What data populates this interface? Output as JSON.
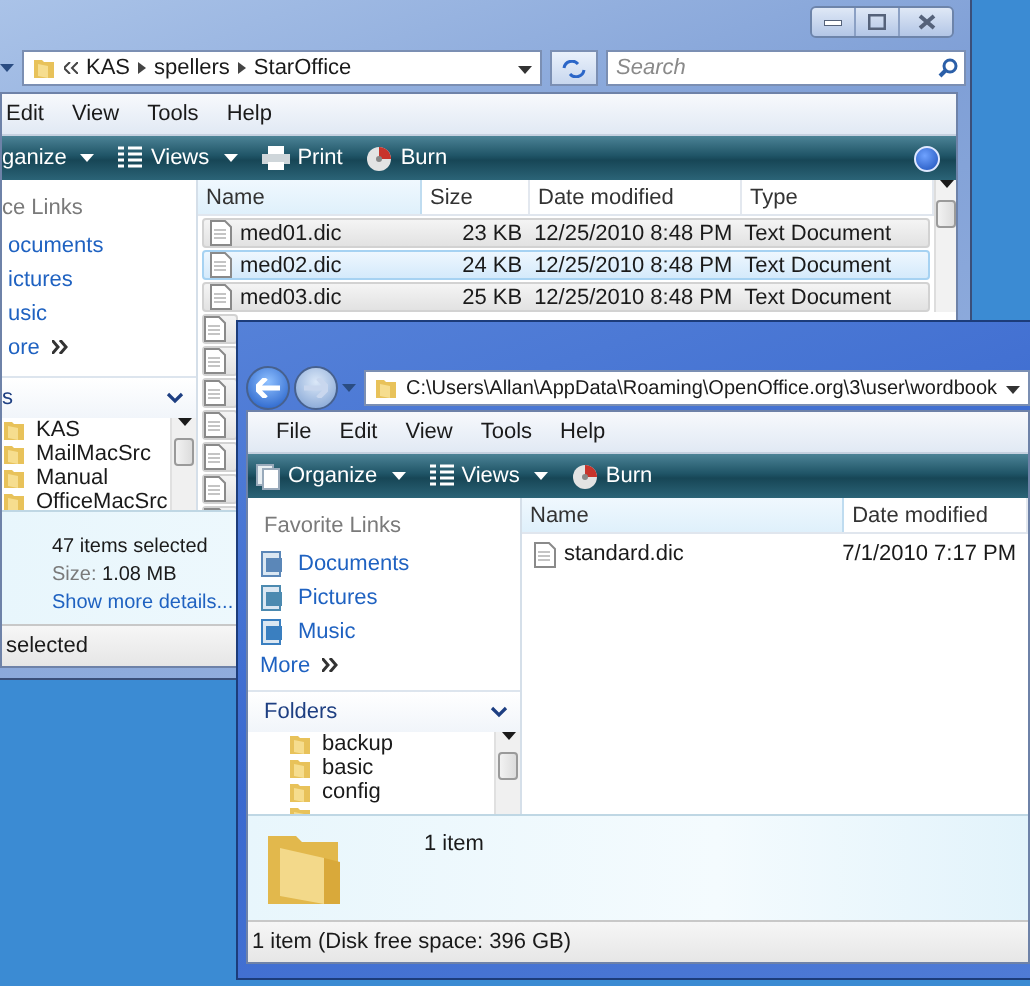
{
  "back_window": {
    "address": {
      "path": [
        "KAS",
        "spellers",
        "StarOffice"
      ]
    },
    "search": {
      "placeholder": "Search"
    },
    "menu": [
      "Edit",
      "View",
      "Tools",
      "Help"
    ],
    "toolbar": [
      {
        "label": "ganize",
        "kind": "organize"
      },
      {
        "label": "Views",
        "kind": "views"
      },
      {
        "label": "Print",
        "kind": "print"
      },
      {
        "label": "Burn",
        "kind": "burn"
      }
    ],
    "favorite_links": {
      "title": "ce Links",
      "items": [
        "ocuments",
        "ictures",
        "usic"
      ],
      "more": "ore"
    },
    "folders": {
      "title": "s",
      "items": [
        "KAS",
        "MailMacSrc",
        "Manual",
        "OfficeMacSrc"
      ]
    },
    "columns": [
      "Name",
      "Size",
      "Date modified",
      "Type"
    ],
    "rows": [
      {
        "name": "med01.dic",
        "size": "23 KB",
        "date": "12/25/2010 8:48 PM",
        "type": "Text Document",
        "selected": true,
        "focused": false
      },
      {
        "name": "med02.dic",
        "size": "24 KB",
        "date": "12/25/2010 8:48 PM",
        "type": "Text Document",
        "selected": true,
        "focused": true
      },
      {
        "name": "med03.dic",
        "size": "25 KB",
        "date": "12/25/2010 8:48 PM",
        "type": "Text Document",
        "selected": true,
        "focused": false
      }
    ],
    "details": {
      "summary": "47 items selected",
      "size_label": "Size:",
      "size": "1.08 MB",
      "link": "Show more details..."
    },
    "status": "selected"
  },
  "front_window": {
    "address": {
      "path_text": "C:\\Users\\Allan\\AppData\\Roaming\\OpenOffice.org\\3\\user\\wordbook"
    },
    "menu": [
      "File",
      "Edit",
      "View",
      "Tools",
      "Help"
    ],
    "toolbar": [
      {
        "label": "Organize",
        "kind": "organize"
      },
      {
        "label": "Views",
        "kind": "views"
      },
      {
        "label": "Burn",
        "kind": "burn"
      }
    ],
    "favorite_links": {
      "title": "Favorite Links",
      "items": [
        "Documents",
        "Pictures",
        "Music"
      ],
      "more": "More"
    },
    "folders": {
      "title": "Folders",
      "items": [
        "backup",
        "basic",
        "config"
      ]
    },
    "columns": [
      "Name",
      "Date modified"
    ],
    "rows": [
      {
        "name": "standard.dic",
        "date": "7/1/2010 7:17 PM",
        "selected": false,
        "focused": false
      }
    ],
    "details": {
      "summary": "1 item"
    },
    "status": "1 item (Disk free space: 396 GB)"
  }
}
